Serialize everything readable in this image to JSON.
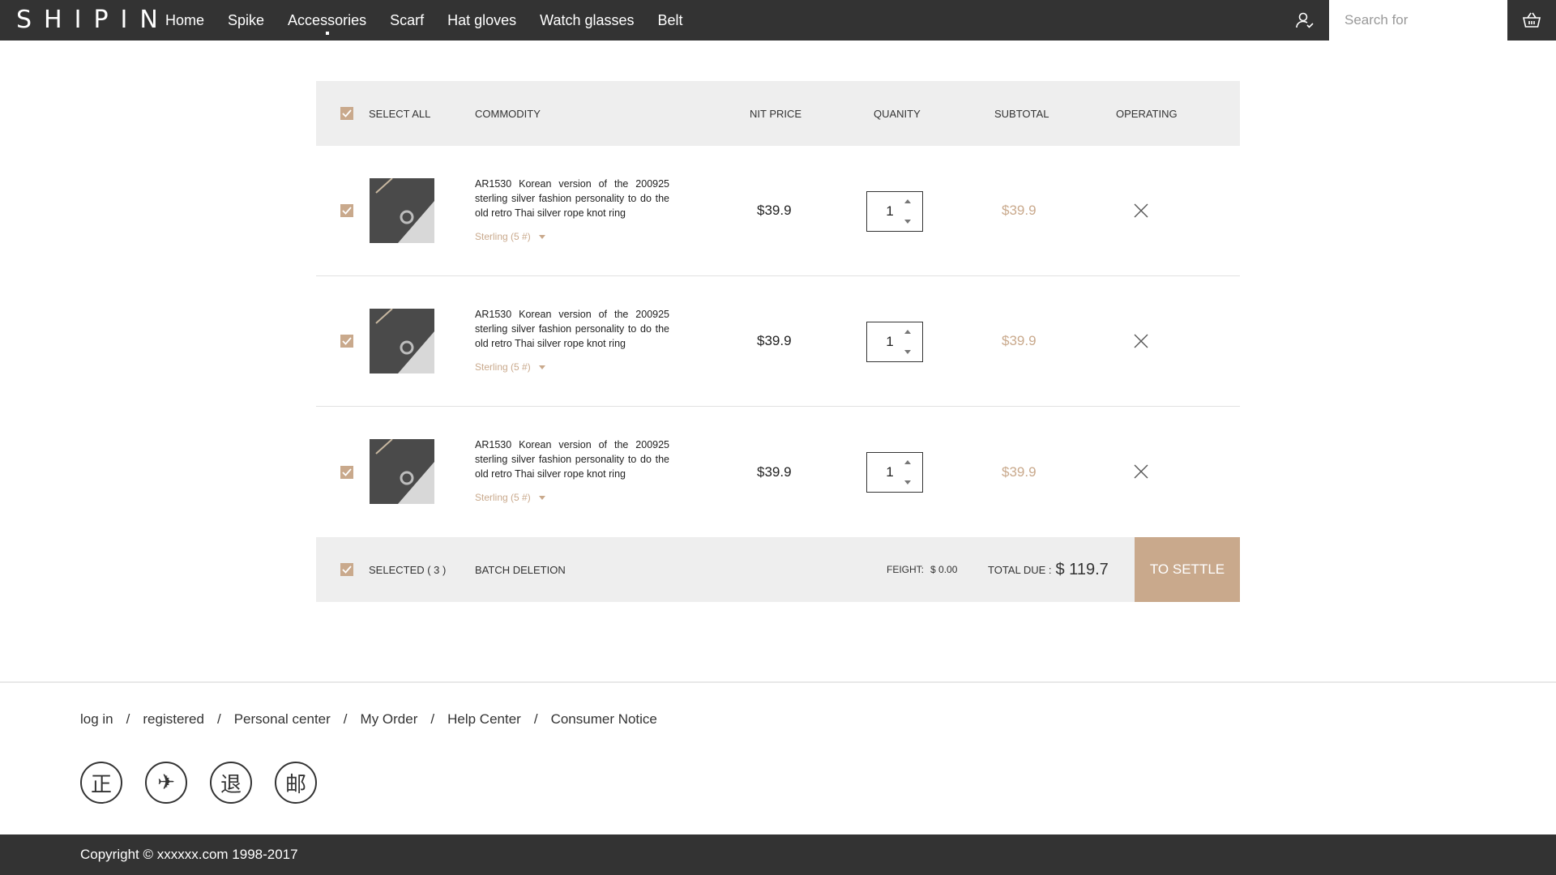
{
  "header": {
    "logo": "SHIPIN",
    "nav": [
      {
        "label": "Home"
      },
      {
        "label": "Spike"
      },
      {
        "label": "Accessories",
        "active": true
      },
      {
        "label": "Scarf"
      },
      {
        "label": "Hat gloves"
      },
      {
        "label": "Watch glasses"
      },
      {
        "label": "Belt"
      }
    ],
    "search_placeholder": "Search for",
    "user_icon": "user-icon",
    "cart_icon": "basket-icon"
  },
  "cart": {
    "header": {
      "select_all": "SELECT ALL",
      "commodity": "COMMODITY",
      "unit_price": "NIT PRICE",
      "quantity": "QUANITY",
      "subtotal": "SUBTOTAL",
      "operating": "OPERATING"
    },
    "items": [
      {
        "checked": true,
        "title": "AR1530 Korean version of the 200925 sterling silver fashion personality to do the old retro Thai silver rope knot ring",
        "spec": "Sterling (5 #)",
        "price": "$39.9",
        "quantity": "1",
        "subtotal": "$39.9"
      },
      {
        "checked": true,
        "title": "AR1530 Korean version of the 200925 sterling silver fashion personality to do the old retro Thai silver rope knot ring",
        "spec": "Sterling (5 #)",
        "price": "$39.9",
        "quantity": "1",
        "subtotal": "$39.9"
      },
      {
        "checked": true,
        "title": "AR1530 Korean version of the 200925 sterling silver fashion personality to do the old retro Thai silver rope knot ring",
        "spec": "Sterling (5 #)",
        "price": "$39.9",
        "quantity": "1",
        "subtotal": "$39.9"
      }
    ],
    "footer": {
      "selected": "SELECTED ( 3 )",
      "batch_delete": "BATCH DELETION",
      "freight_label": "FEIGHT:",
      "freight_value": "$ 0.00",
      "total_label": "TOTAL  DUE :",
      "total_value": "$ 119.7",
      "settle": "TO SETTLE"
    }
  },
  "footer": {
    "links": [
      "log in",
      "registered",
      "Personal center",
      "My Order",
      "Help Center",
      "Consumer Notice"
    ],
    "separator": "/",
    "badges": [
      "正",
      "✈",
      "退",
      "邮"
    ],
    "copyright": "Copyright © xxxxxx.com 1998-2017"
  },
  "colors": {
    "topbar": "#333333",
    "accent": "#c9a98c",
    "table_band": "#eeeeee"
  }
}
